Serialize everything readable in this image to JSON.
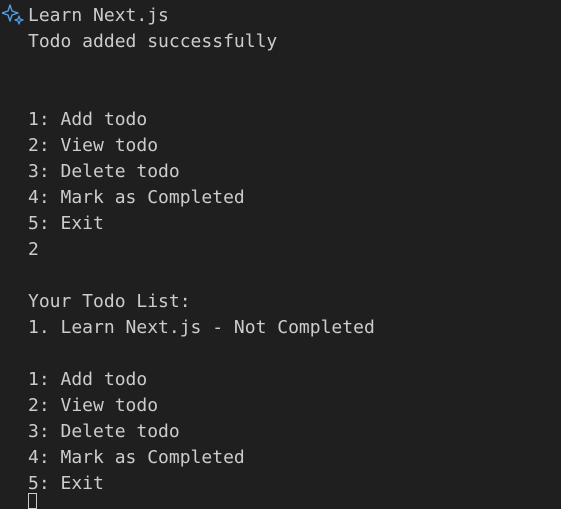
{
  "terminal": {
    "command_text": "Learn Next.js",
    "message": "Todo added successfully",
    "menu_1": {
      "add": "1: Add todo",
      "view": "2: View todo",
      "delete": "3: Delete todo",
      "mark": "4: Mark as Completed",
      "exit": "5: Exit"
    },
    "user_input": "2",
    "list_header": "Your Todo List:",
    "list_item_1": "1. Learn Next.js - Not Completed",
    "menu_2": {
      "add": "1: Add todo",
      "view": "2: View todo",
      "delete": "3: Delete todo",
      "mark": "4: Mark as Completed",
      "exit": "5: Exit"
    }
  },
  "colors": {
    "background": "#1f1f1f",
    "text": "#cccccc",
    "sparkle_icon": "#4f9fe8"
  },
  "icons": {
    "prompt_icon": "sparkle-icon"
  }
}
